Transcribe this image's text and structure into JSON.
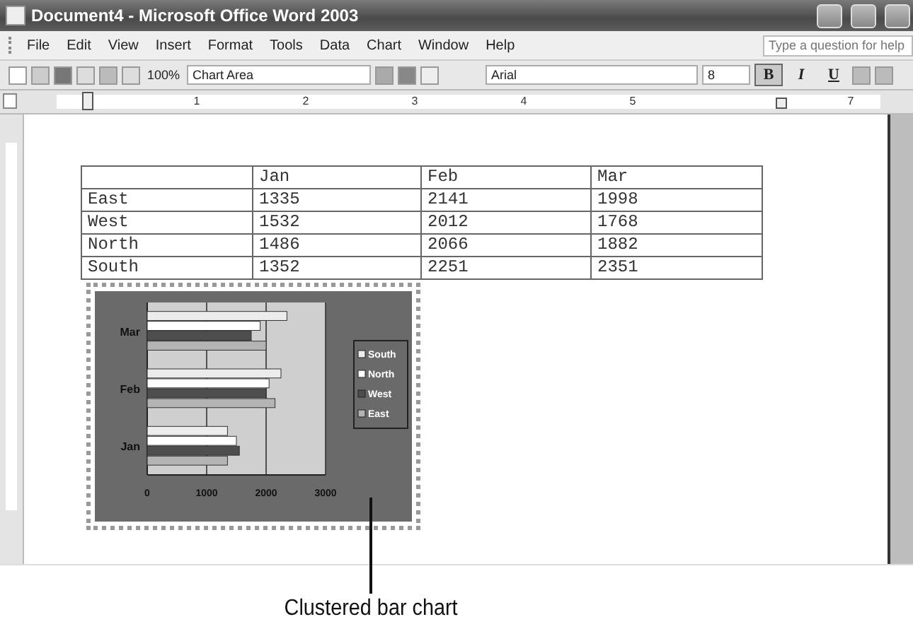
{
  "window": {
    "title": "Document4 - Microsoft Office Word 2003"
  },
  "menu": {
    "items": [
      "File",
      "Edit",
      "View",
      "Insert",
      "Format",
      "Tools",
      "Data",
      "Chart",
      "Window",
      "Help"
    ],
    "help_search": {
      "placeholder": "Type a question for help"
    }
  },
  "toolbar": {
    "zoom": "100%",
    "chart_element": "Chart Area",
    "font": "Arial",
    "font_size": "8",
    "format_buttons": [
      {
        "label": "B",
        "on": true
      },
      {
        "label": "I",
        "on": false
      },
      {
        "label": "U",
        "on": false
      }
    ]
  },
  "ruler": {
    "labels": [
      "1",
      "2",
      "3",
      "4",
      "5",
      "7"
    ]
  },
  "table": {
    "columns": [
      "",
      "Jan",
      "Feb",
      "Mar"
    ],
    "rows": [
      [
        "East",
        "1335",
        "2141",
        "1998"
      ],
      [
        "West",
        "1532",
        "2012",
        "1768"
      ],
      [
        "North",
        "1486",
        "2066",
        "1882"
      ],
      [
        "South",
        "1352",
        "2251",
        "2351"
      ]
    ]
  },
  "chart": {
    "chart_data": {
      "type": "bar",
      "orientation": "horizontal",
      "categories": [
        "Mar",
        "Feb",
        "Jan"
      ],
      "xlim": [
        0,
        3000
      ],
      "xticks": [
        0,
        1000,
        2000,
        3000
      ],
      "legend": true,
      "series": [
        {
          "name": "East",
          "color": "#b4b4b4",
          "values": [
            2000,
            2150,
            1350
          ]
        },
        {
          "name": "West",
          "color": "#4e4e4e",
          "values": [
            1750,
            2000,
            1550
          ]
        },
        {
          "name": "North",
          "color": "#ffffff",
          "values": [
            1900,
            2050,
            1500
          ]
        },
        {
          "name": "South",
          "color": "#ececec",
          "values": [
            2350,
            2250,
            1350
          ]
        }
      ]
    }
  },
  "callout": {
    "text": "Clustered bar chart"
  }
}
